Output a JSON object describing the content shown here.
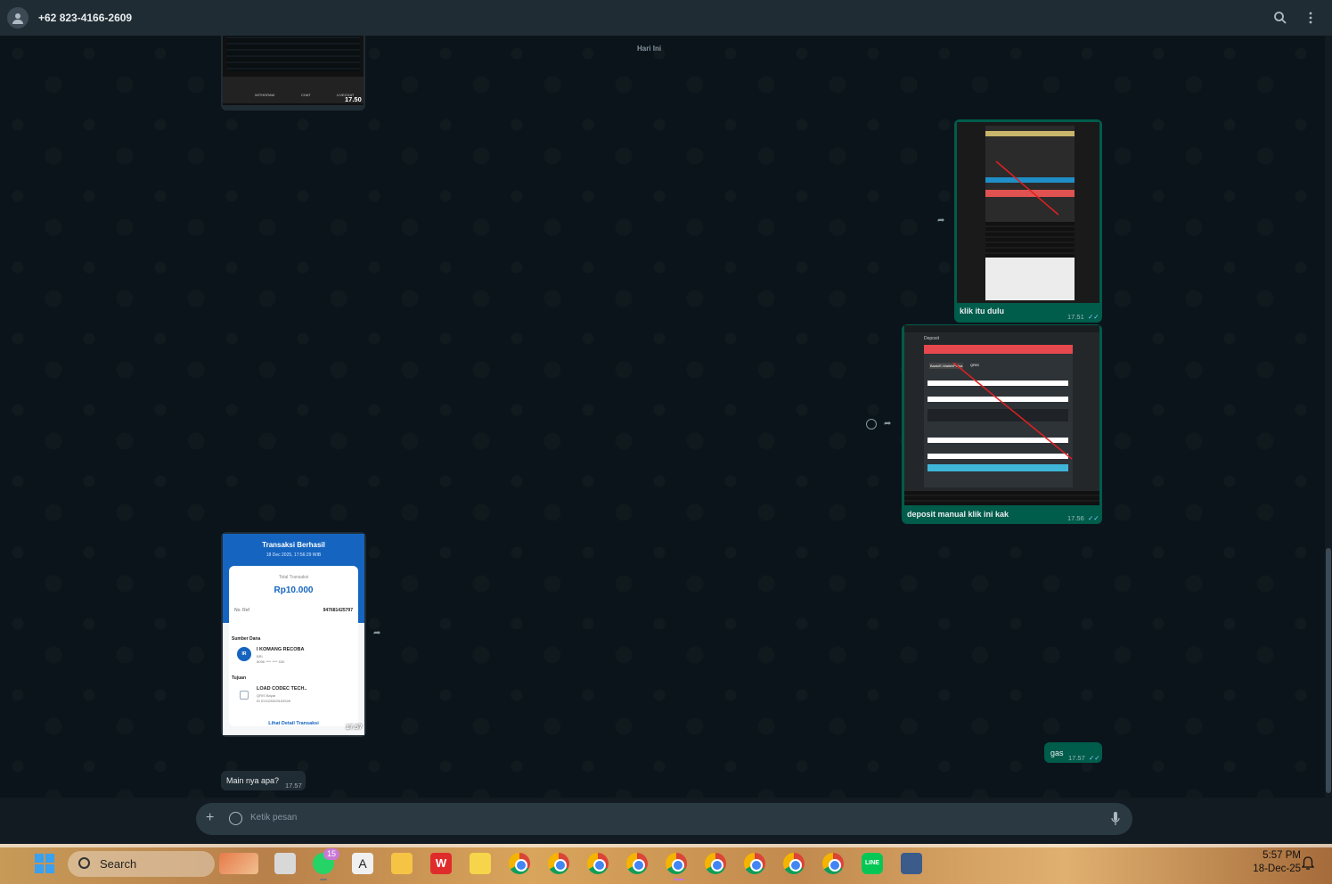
{
  "header": {
    "contact_name": "+62 823-4166-2609",
    "icons": [
      "avatar-icon",
      "search-icon",
      "menu-dots-icon"
    ]
  },
  "chat": {
    "date_chip": "Hari Ini",
    "messages": [
      {
        "direction": "in",
        "type": "image",
        "time": "17.50",
        "preview_labels": [
          "WITHDRAW",
          "CHAT",
          "LIVECHAT"
        ]
      },
      {
        "direction": "out",
        "type": "image",
        "caption": "klik itu dulu",
        "time": "17.51"
      },
      {
        "direction": "out",
        "type": "image",
        "caption": "deposit manual klik ini kak",
        "time": "17.56",
        "preview_labels": [
          "Deposit",
          "Bank/E-Wallet/Pulsa",
          "QRIS"
        ]
      },
      {
        "direction": "in",
        "type": "image",
        "time": "17.57",
        "receipt": {
          "title": "Transaksi Berhasil",
          "datetime": "18 Dec 2025, 17:56:29 WIB",
          "total_label": "Total Transaksi",
          "amount": "Rp10.000",
          "ref_label": "No. Ref",
          "ref_value": "947681425797",
          "source_label": "Sumber Dana",
          "source_initials": "IR",
          "source_name": "I KOMANG RECOBA",
          "source_bank": "BRI",
          "source_account": "8096 **** **** 530",
          "dest_label": "Tujuan",
          "dest_name": "LOAD CODEC TECH..",
          "dest_type": "QRIS Bayar",
          "dest_id": "ID ID1025309163526",
          "detail_link": "Lihat Detail Transaksi"
        }
      },
      {
        "direction": "out",
        "type": "text",
        "text": "gas",
        "time": "17.57"
      },
      {
        "direction": "in",
        "type": "text",
        "text": "Main nya apa?",
        "time": "17.57"
      }
    ]
  },
  "composer": {
    "placeholder": "Ketik pesan",
    "icons": [
      "plus-icon",
      "sticker-icon",
      "mic-icon"
    ]
  },
  "taskbar": {
    "search_label": "Search",
    "whatsapp_badge": "15",
    "time": "5:57 PM",
    "date": "18-Dec-25"
  }
}
